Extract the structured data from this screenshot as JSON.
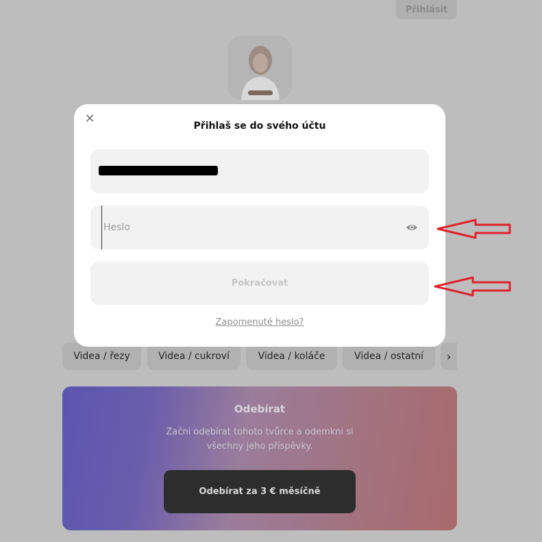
{
  "header": {
    "login_label": "Přihlásit"
  },
  "creator": {
    "avatar": "creator-avatar-photo"
  },
  "categories": {
    "items": [
      {
        "label": "Videa / řezy"
      },
      {
        "label": "Videa / cukroví"
      },
      {
        "label": "Videa / koláče"
      },
      {
        "label": "Videa / ostatní"
      }
    ],
    "next_icon": "chevron-right-icon"
  },
  "subscribe": {
    "title": "Odebírat",
    "description": "Začni odebírat tohoto tvůrce a odemkni si všechny jeho příspěvky.",
    "button_label": "Odebírat za 3 € měsíčně",
    "gradient_colors": [
      "#5c55b0",
      "#9a7d9b",
      "#a86a6c"
    ]
  },
  "modal": {
    "title": "Přihlaš se do svého účtu",
    "close_icon": "close-icon",
    "email_value_redacted": true,
    "password": {
      "placeholder": "Heslo",
      "value": "",
      "toggle_icon": "eye-icon"
    },
    "continue_label": "Pokračovat",
    "forgot_label": "Zapomenuté heslo?"
  },
  "annotations": {
    "arrow_color": "#e0202a"
  }
}
